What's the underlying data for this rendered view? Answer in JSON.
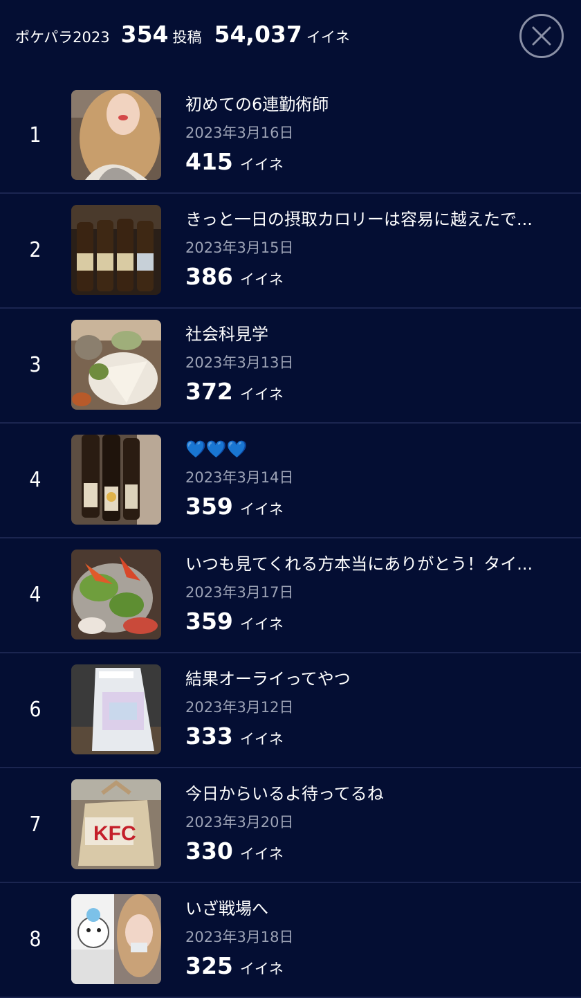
{
  "header": {
    "app_name": "ポケパラ2023",
    "post_count": "354",
    "post_unit": "投稿",
    "like_count": "54,037",
    "like_unit": "イイネ"
  },
  "colors": {
    "background": "#040e33",
    "divider": "#1b2550",
    "date_text": "#9da3b6"
  },
  "icons": {
    "close": "close-icon"
  },
  "posts": [
    {
      "rank": "1",
      "title": "初めての6連勤術師",
      "date": "2023年3月16日",
      "likes": "415",
      "like_unit": "イイネ",
      "thumbnail": "photo-woman-portrait"
    },
    {
      "rank": "2",
      "title": "きっと一日の摂取カロリーは容易に越えたで...",
      "date": "2023年3月15日",
      "likes": "386",
      "like_unit": "イイネ",
      "thumbnail": "photo-beer-bottles"
    },
    {
      "rank": "3",
      "title": "社会科見学",
      "date": "2023年3月13日",
      "likes": "372",
      "like_unit": "イイネ",
      "thumbnail": "photo-food-table"
    },
    {
      "rank": "4",
      "title": "💙💙💙",
      "date": "2023年3月14日",
      "likes": "359",
      "like_unit": "イイネ",
      "thumbnail": "photo-sake-bottles"
    },
    {
      "rank": "4",
      "title": "いつも見てくれる方本当にありがとう！タイ...",
      "date": "2023年3月17日",
      "likes": "359",
      "like_unit": "イイネ",
      "thumbnail": "photo-seafood-dish"
    },
    {
      "rank": "6",
      "title": "結果オーライってやつ",
      "date": "2023年3月12日",
      "likes": "333",
      "like_unit": "イイネ",
      "thumbnail": "photo-shopping-bag"
    },
    {
      "rank": "7",
      "title": "今日からいるよ待ってるね",
      "date": "2023年3月20日",
      "likes": "330",
      "like_unit": "イイネ",
      "thumbnail": "photo-kfc-box"
    },
    {
      "rank": "8",
      "title": "いざ戦場へ",
      "date": "2023年3月18日",
      "likes": "325",
      "like_unit": "イイネ",
      "thumbnail": "photo-woman-with-bear"
    }
  ]
}
